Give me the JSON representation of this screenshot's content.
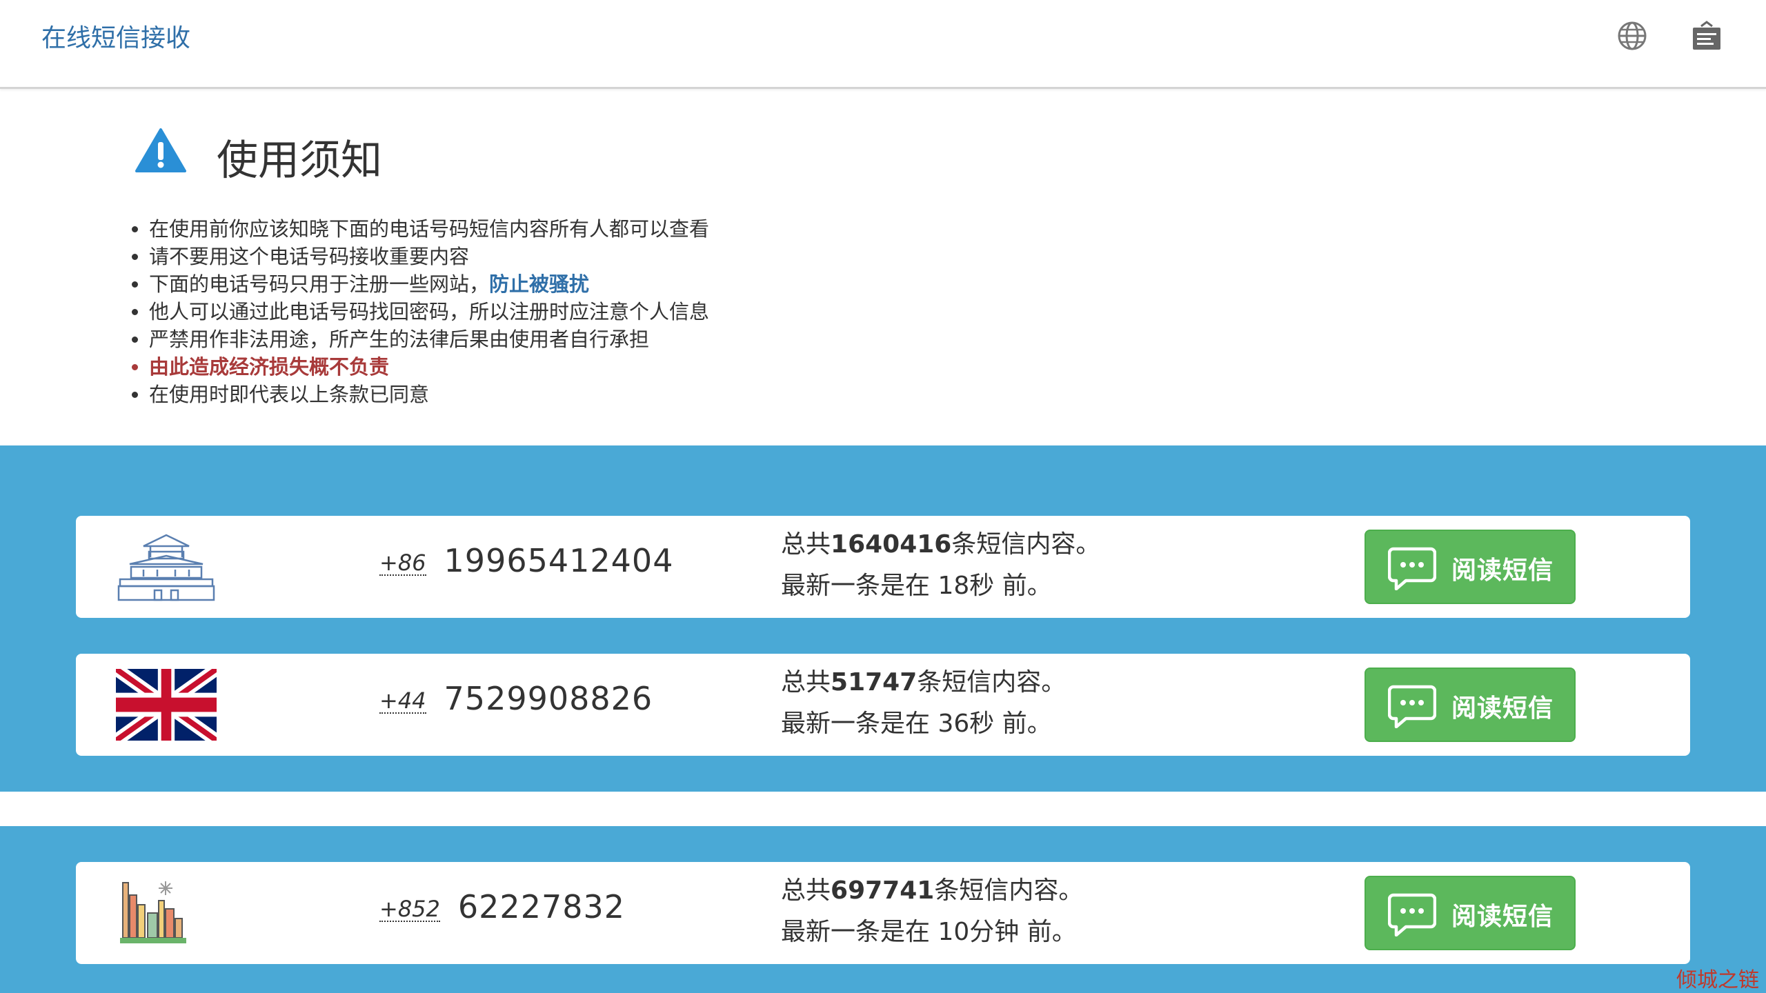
{
  "header": {
    "brand": "在线短信接收",
    "icons": [
      "globe-icon",
      "newspaper-icon"
    ]
  },
  "notice": {
    "icon": "warning-icon",
    "title": "使用须知",
    "items": [
      "在使用前你应该知晓下面的电话号码短信内容所有人都可以查看",
      "请不要用这个电话号码接收重要内容",
      "下面的电话号码只用于注册一些网站，",
      "他人可以通过此电话号码找回密码，所以注册时应注意个人信息",
      "严禁用作非法用途，所产生的法律后果由使用者自行承担",
      "由此造成经济损失概不负责",
      "在使用时即代表以上条款已同意"
    ],
    "item3_highlight": "防止被骚扰"
  },
  "numbers": [
    {
      "flag": "china-palace-icon",
      "country_code": "+86",
      "number": "19965412404",
      "total_prefix": "总共",
      "total_count": "1640416",
      "total_suffix": "条短信内容。",
      "latest": "最新一条是在 18秒 前。",
      "button": "阅读短信"
    },
    {
      "flag": "uk-flag-icon",
      "country_code": "+44",
      "number": "7529908826",
      "total_prefix": "总共",
      "total_count": "51747",
      "total_suffix": "条短信内容。",
      "latest": "最新一条是在 36秒 前。",
      "button": "阅读短信"
    },
    {
      "flag": "hongkong-skyline-icon",
      "country_code": "+852",
      "number": "62227832",
      "total_prefix": "总共",
      "total_count": "697741",
      "total_suffix": "条短信内容。",
      "latest": "最新一条是在 10分钟 前。",
      "button": "阅读短信"
    }
  ],
  "watermark": "倾城之链",
  "colors": {
    "band_blue": "#4aa9d6",
    "button_green": "#5cb85c",
    "link_blue": "#2f6fa8",
    "warning_red": "#a83a3a"
  }
}
